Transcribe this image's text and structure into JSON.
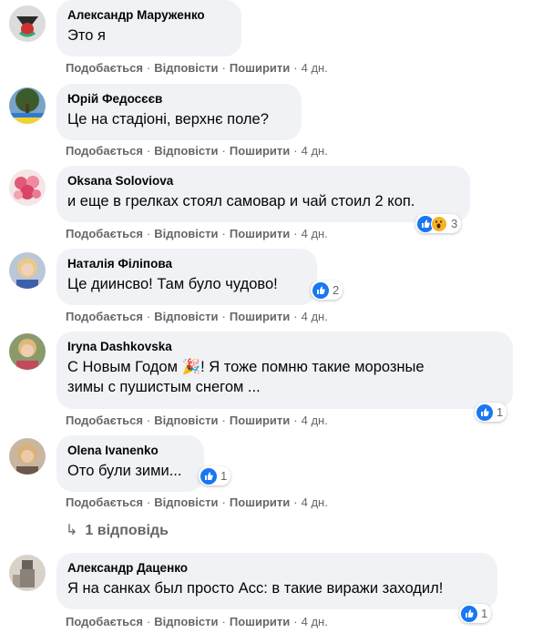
{
  "actions": {
    "like": "Подобається",
    "reply": "Відповісти",
    "share": "Поширити",
    "separator": "·"
  },
  "comments": [
    {
      "author": "Александр Маруженко",
      "text": "Это я",
      "time": "4 дн.",
      "avatar_icon": "profile-photo-avatar"
    },
    {
      "author": "Юрій Федосєєв",
      "text": "Це на стадіоні, верхнє поле?",
      "time": "4 дн.",
      "avatar_icon": "tree-photo-avatar"
    },
    {
      "author": "Oksana Soloviova",
      "text": "и еще в грелках стоял самовар и чай стоил 2 коп.",
      "time": "4 дн.",
      "avatar_icon": "roses-photo-avatar",
      "reactions": {
        "icons": [
          "like",
          "wow"
        ],
        "count": "3"
      }
    },
    {
      "author": "Наталія Філіпова",
      "text": "Це диинсво! Там було чудово!",
      "time": "4 дн.",
      "avatar_icon": "profile-photo-avatar",
      "reactions": {
        "icons": [
          "like"
        ],
        "count": "2"
      }
    },
    {
      "author": "Iryna Dashkovska",
      "text_line1": "С Новым Годом 🎉! Я тоже помню такие морозные",
      "text_line2": "зимы с пушистым снегом ...",
      "time": "4 дн.",
      "avatar_icon": "profile-photo-avatar",
      "reactions": {
        "icons": [
          "like"
        ],
        "count": "1"
      }
    },
    {
      "author": "Olena Ivanenko",
      "text": "Ото були зими...",
      "time": "4 дн.",
      "avatar_icon": "profile-photo-avatar",
      "reactions": {
        "icons": [
          "like"
        ],
        "count": "1"
      }
    },
    {
      "author": "Александр Даценко",
      "text": "Я на санках был просто Асс: в такие виражи заходил!",
      "time": "4 дн.",
      "avatar_icon": "profile-photo-avatar",
      "reactions": {
        "icons": [
          "like"
        ],
        "count": "1"
      }
    }
  ],
  "replies_link": {
    "arrow": "↳",
    "label": "1 відповідь"
  },
  "colors": {
    "bubble": "#f0f2f5",
    "meta_text": "#65676b",
    "like_blue": "#1877f2",
    "wow_yellow": "#f7b125"
  }
}
